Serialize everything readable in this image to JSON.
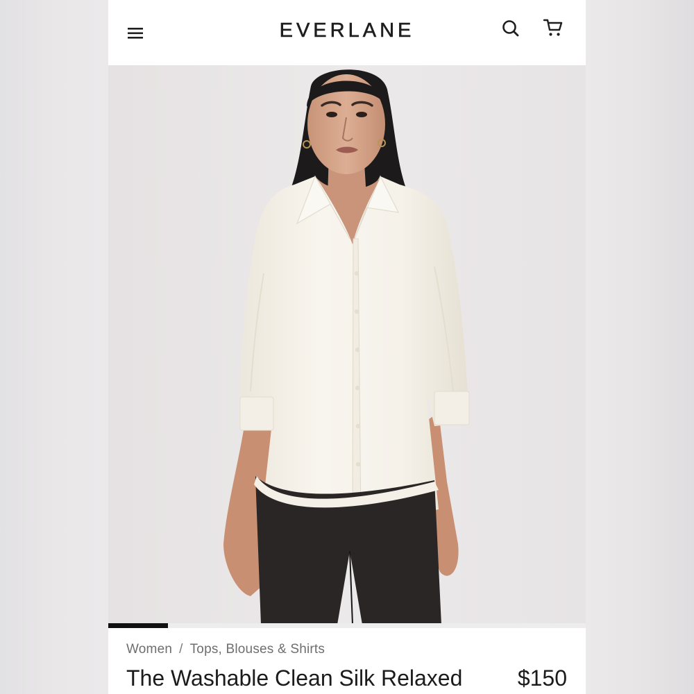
{
  "header": {
    "logo": "EVERLANE",
    "menu_icon": "hamburger-menu-icon",
    "search_icon": "search-icon",
    "cart_icon": "shopping-cart-icon"
  },
  "product": {
    "image_alt": "Model wearing The Washable Clean Silk Relaxed shirt",
    "carousel": {
      "current": 1,
      "total": 8
    },
    "breadcrumb": [
      "Women",
      "Tops, Blouses & Shirts"
    ],
    "breadcrumb_separator": "/",
    "title": "The Washable Clean Silk Relaxed",
    "price": "$150"
  },
  "colors": {
    "brand_text": "#1e1e1e",
    "background": "#ebe9ea",
    "shirt": "#f7f4ec",
    "pants": "#2a2626"
  }
}
